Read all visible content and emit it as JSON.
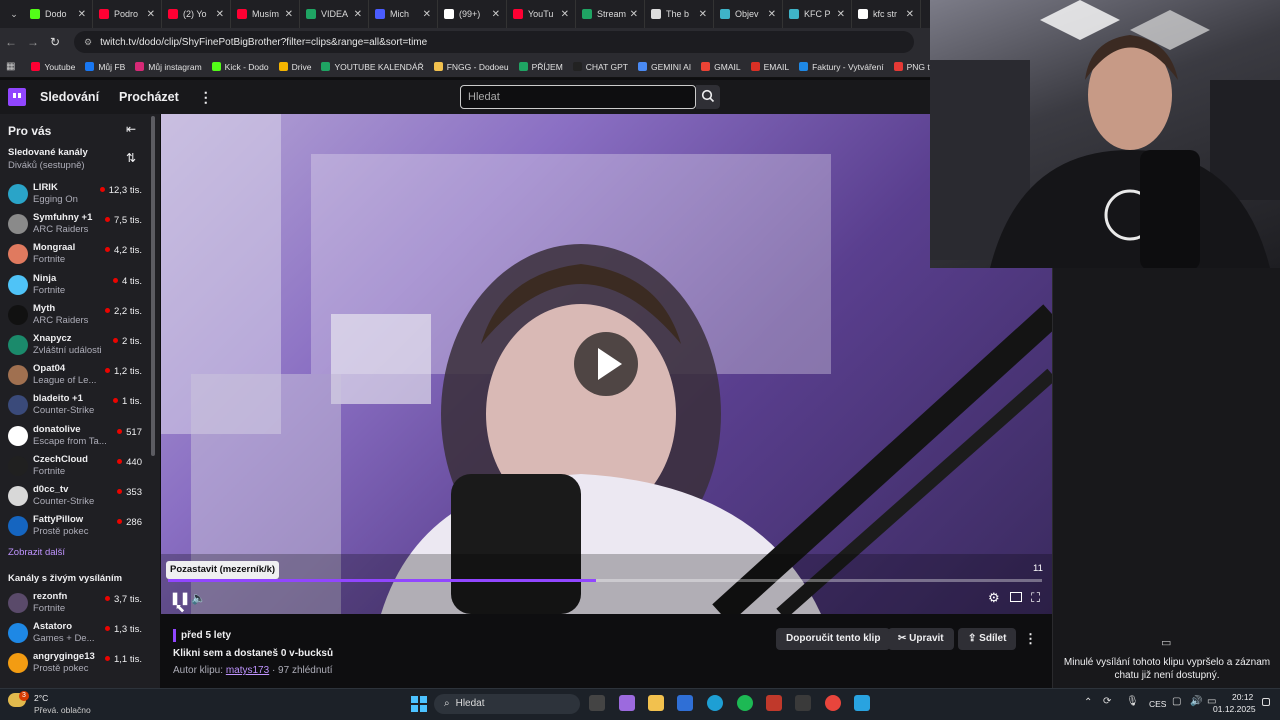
{
  "browser": {
    "tabs": [
      {
        "label": "Dodo",
        "icon": "kick-icon",
        "color": "#53fc18"
      },
      {
        "label": "Podro",
        "icon": "youtube-icon",
        "color": "#ff0033"
      },
      {
        "label": "(2) Yo",
        "icon": "youtube-icon",
        "color": "#ff0033"
      },
      {
        "label": "Musím",
        "icon": "youtube-icon",
        "color": "#ff0033"
      },
      {
        "label": "VIDEA",
        "icon": "sheets-icon",
        "color": "#1fa463"
      },
      {
        "label": "Mich",
        "icon": "link-icon",
        "color": "#4a5cff"
      },
      {
        "label": "(99+)",
        "icon": "tiktok-icon",
        "color": "#ffffff"
      },
      {
        "label": "YouTu",
        "icon": "youtube-icon",
        "color": "#ff0033"
      },
      {
        "label": "Stream",
        "icon": "sheets-icon",
        "color": "#1fa463"
      },
      {
        "label": "The b",
        "icon": "shield-icon",
        "color": "#dddddd"
      },
      {
        "label": "Objev",
        "icon": "globe-icon",
        "color": "#3fb4c8"
      },
      {
        "label": "KFC P",
        "icon": "globe-icon",
        "color": "#3fb4c8"
      },
      {
        "label": "kfc str",
        "icon": "google-icon",
        "color": "#ffffff"
      }
    ],
    "url": "twitch.tv/dodo/clip/ShyFinePotBigBrother?filter=clips&range=all&sort=time",
    "bookmarks": [
      {
        "label": "Youtube",
        "color": "#ff0033"
      },
      {
        "label": "Můj FB",
        "color": "#1877f2"
      },
      {
        "label": "Můj instagram",
        "color": "#d62976"
      },
      {
        "label": "Kick - Dodo",
        "color": "#53fc18"
      },
      {
        "label": "Drive",
        "color": "#f4b400"
      },
      {
        "label": "YOUTUBE KALENDÁŘ",
        "color": "#1fa463"
      },
      {
        "label": "FNGG - Dodoeu",
        "color": "#f2c14e"
      },
      {
        "label": "PŘÍJEM",
        "color": "#1fa463"
      },
      {
        "label": "CHAT GPT",
        "color": "#222222"
      },
      {
        "label": "GEMINI AI",
        "color": "#4a8af4"
      },
      {
        "label": "GMAIL",
        "color": "#ea4335"
      },
      {
        "label": "EMAIL",
        "color": "#d93025"
      },
      {
        "label": "Faktury - Vytváření",
        "color": "#1e88e5"
      },
      {
        "label": "PNG to PD",
        "color": "#e53935"
      }
    ]
  },
  "twitch": {
    "nav": {
      "following": "Sledování",
      "browse": "Procházet",
      "search_placeholder": "Hledat"
    },
    "sidebar": {
      "header": "Pro vás",
      "followed_title": "Sledované kanály",
      "followed_sort": "Diváků (sestupně)",
      "followed": [
        {
          "name": "LIRIK",
          "game": "Egging On",
          "viewers": "12,3 tis.",
          "color": "#2aa4c8"
        },
        {
          "name": "Symfuhny +1",
          "game": "ARC Raiders",
          "viewers": "7,5 tis.",
          "color": "#8a8a8a"
        },
        {
          "name": "Mongraal",
          "game": "Fortnite",
          "viewers": "4,2 tis.",
          "color": "#e07a5f"
        },
        {
          "name": "Ninja",
          "game": "Fortnite",
          "viewers": "4 tis.",
          "color": "#4fc3f7"
        },
        {
          "name": "Myth",
          "game": "ARC Raiders",
          "viewers": "2,2 tis.",
          "color": "#111111"
        },
        {
          "name": "Xnapycz",
          "game": "Zvláštní události",
          "viewers": "2 tis.",
          "color": "#1b8a6b"
        },
        {
          "name": "Opat04",
          "game": "League of Le...",
          "viewers": "1,2 tis.",
          "color": "#a07050"
        },
        {
          "name": "bladeito +1",
          "game": "Counter-Strike",
          "viewers": "1 tis.",
          "color": "#3a4a7a"
        },
        {
          "name": "donatolive",
          "game": "Escape from Ta...",
          "viewers": "517",
          "color": "#ffffff"
        },
        {
          "name": "CzechCloud",
          "game": "Fortnite",
          "viewers": "440",
          "color": "#202020"
        },
        {
          "name": "d0cc_tv",
          "game": "Counter-Strike",
          "viewers": "353",
          "color": "#d8d8d8"
        },
        {
          "name": "FattyPillow",
          "game": "Prostě pokec",
          "viewers": "286",
          "color": "#1565c0"
        }
      ],
      "show_more": "Zobrazit další",
      "live_title": "Kanály s živým vysíláním",
      "live": [
        {
          "name": "rezonfn",
          "game": "Fortnite",
          "viewers": "3,7 tis.",
          "color": "#5a4a6a"
        },
        {
          "name": "Astatoro",
          "game": "Games + De...",
          "viewers": "1,3 tis.",
          "color": "#1e88e5"
        },
        {
          "name": "angryginge13",
          "game": "Prostě pokec",
          "viewers": "1,1 tis.",
          "color": "#f39c12"
        }
      ]
    },
    "player": {
      "tooltip": "Pozastavit (mezerník/k)",
      "time": "11",
      "progress": 0.49
    },
    "clip": {
      "age": "před 5 lety",
      "title": "Klikni sem a dostaneš 0 v-bucksů",
      "author_prefix": "Autor klipu:",
      "author": "matys173",
      "views": "· 97 zhlédnutí",
      "recommend": "Doporučit tento klip",
      "edit": "Upravit",
      "share": "Sdílet"
    },
    "chat_notice": "Minulé vysílání tohoto klipu vypršelo a záznam chatu již není dostupný."
  },
  "taskbar": {
    "weather_temp": "2°C",
    "weather_desc": "Převá. oblačno",
    "weather_badge": "3",
    "search": "Hledat",
    "lang": "CES",
    "time": "20:12",
    "date": "01.12.2025"
  }
}
